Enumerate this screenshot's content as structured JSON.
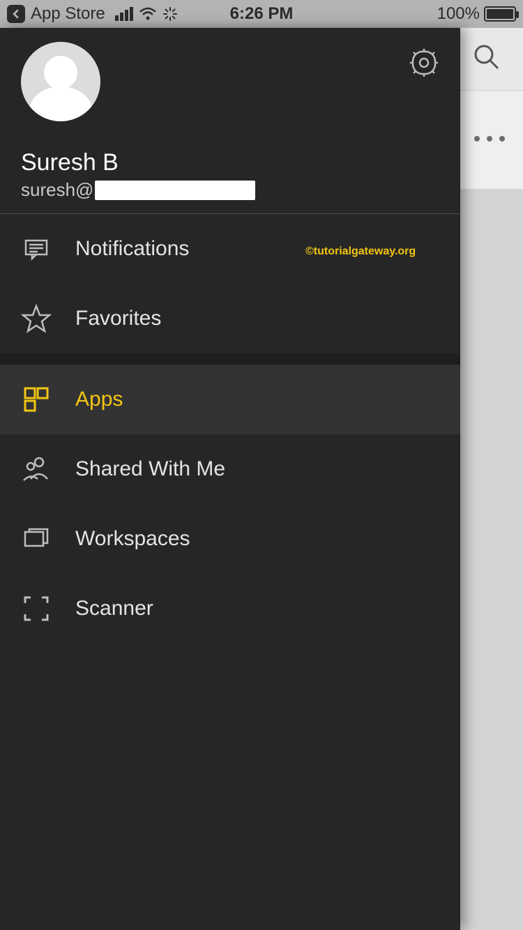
{
  "statusbar": {
    "back_label": "App Store",
    "time": "6:26 PM",
    "battery_pct": "100%"
  },
  "user": {
    "name": "Suresh B",
    "email_prefix": "suresh@"
  },
  "watermark": "©tutorialgateway.org",
  "menu": {
    "notifications": "Notifications",
    "favorites": "Favorites",
    "apps": "Apps",
    "shared": "Shared With Me",
    "workspaces": "Workspaces",
    "scanner": "Scanner"
  }
}
